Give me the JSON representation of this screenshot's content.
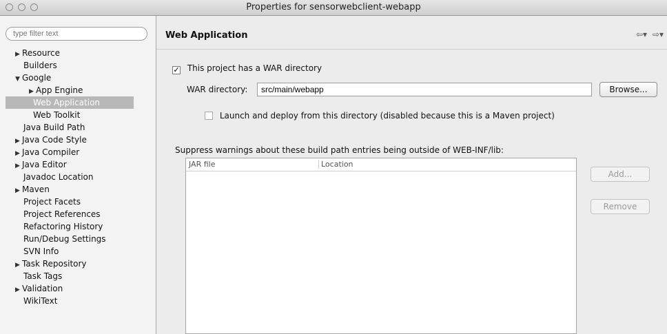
{
  "window": {
    "title": "Properties for sensorwebclient-webapp"
  },
  "filter": {
    "placeholder": "type filter text"
  },
  "tree": [
    {
      "label": "Resource",
      "twisty": "▶"
    },
    {
      "label": "Builders",
      "twisty": ""
    },
    {
      "label": "Google",
      "twisty": "▼"
    },
    {
      "label": "App Engine",
      "twisty": "▶"
    },
    {
      "label": "Web Application",
      "twisty": "",
      "selected": true
    },
    {
      "label": "Web Toolkit",
      "twisty": ""
    },
    {
      "label": "Java Build Path",
      "twisty": ""
    },
    {
      "label": "Java Code Style",
      "twisty": "▶"
    },
    {
      "label": "Java Compiler",
      "twisty": "▶"
    },
    {
      "label": "Java Editor",
      "twisty": "▶"
    },
    {
      "label": "Javadoc Location",
      "twisty": ""
    },
    {
      "label": "Maven",
      "twisty": "▶"
    },
    {
      "label": "Project Facets",
      "twisty": ""
    },
    {
      "label": "Project References",
      "twisty": ""
    },
    {
      "label": "Refactoring History",
      "twisty": ""
    },
    {
      "label": "Run/Debug Settings",
      "twisty": ""
    },
    {
      "label": "SVN Info",
      "twisty": ""
    },
    {
      "label": "Task Repository",
      "twisty": "▶"
    },
    {
      "label": "Task Tags",
      "twisty": ""
    },
    {
      "label": "Validation",
      "twisty": "▶"
    },
    {
      "label": "WikiText",
      "twisty": ""
    }
  ],
  "page": {
    "header": "Web Application",
    "war_checkbox_label": "This project has a WAR directory",
    "war_checked": true,
    "war_dir_label": "WAR directory:",
    "war_dir_value": "src/main/webapp",
    "browse_label": "Browse...",
    "launch_label": "Launch and deploy from this directory (disabled because this is a Maven project)",
    "suppress_label": "Suppress warnings about these build path entries being outside of WEB-INF/lib:",
    "table": {
      "col1": "JAR file",
      "col2": "Location"
    },
    "add_label": "Add...",
    "remove_label": "Remove"
  }
}
